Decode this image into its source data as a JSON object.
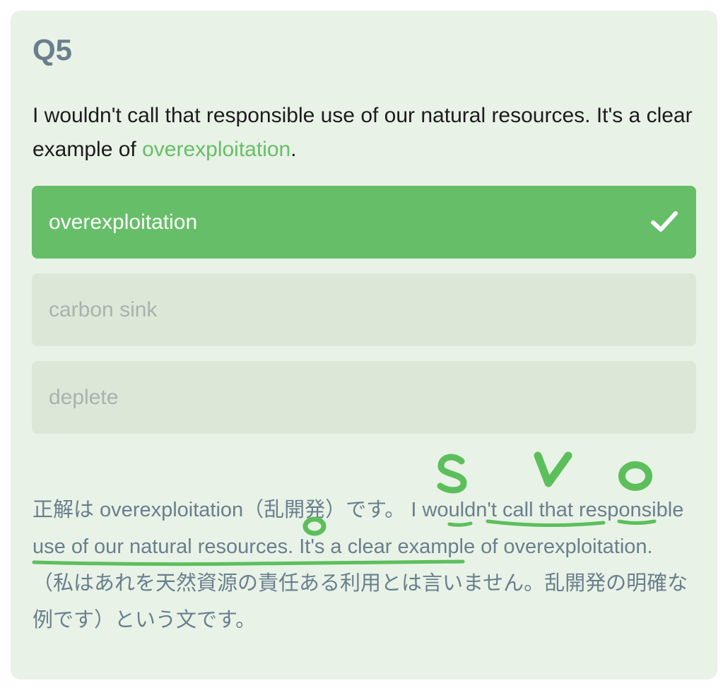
{
  "question": {
    "number": "Q5",
    "text_before": "I wouldn't call that responsible use of our natural resources. It's a clear example of ",
    "answer_word": "overexploitation",
    "text_after": "."
  },
  "options": [
    {
      "label": "overexploitation",
      "state": "correct"
    },
    {
      "label": "carbon sink",
      "state": "unselected"
    },
    {
      "label": "deplete",
      "state": "unselected"
    }
  ],
  "explanation": {
    "text": "正解は overexploitation（乱開発）です。 I wouldn't call that responsible use of our natural resources. It's a clear example of overexploitation.（私はあれを天然資源の責任ある利用とは言いません。乱開発の明確な例です）という文です。"
  },
  "annotations": {
    "labels": [
      "S",
      "V",
      "O",
      "O"
    ],
    "color": "#5cbf5c"
  },
  "colors": {
    "card_bg": "#e8f2e6",
    "accent": "#66bf68",
    "question_number": "#6a7f8d",
    "option_inactive_bg": "#dce7d8",
    "option_inactive_text": "#a9b2ad"
  }
}
